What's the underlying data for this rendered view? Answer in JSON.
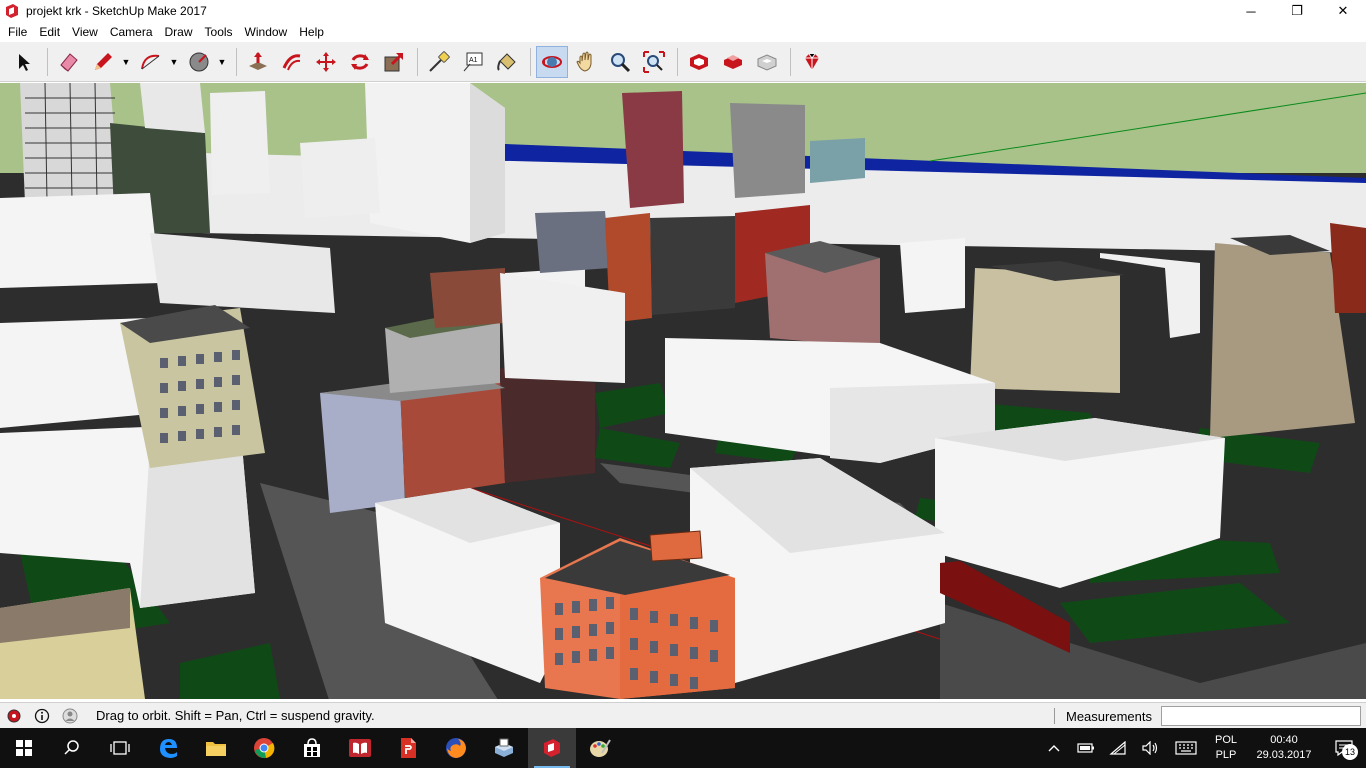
{
  "window": {
    "title": "projekt krk - SketchUp Make 2017",
    "controls": {
      "minimize": "─",
      "maximize": "❐",
      "close": "✕"
    }
  },
  "menu": [
    "File",
    "Edit",
    "View",
    "Camera",
    "Draw",
    "Tools",
    "Window",
    "Help"
  ],
  "toolbar": {
    "tools": [
      "select-tool",
      "eraser-tool",
      "pencil-tool",
      "arc-tool",
      "shapes-tool",
      "push-pull-tool",
      "offset-tool",
      "move-tool",
      "rotate-tool",
      "scale-tool",
      "tape-measure-tool",
      "text-tool",
      "paint-bucket-tool",
      "orbit-tool",
      "pan-tool",
      "zoom-tool",
      "zoom-extents-tool",
      "warehouse-tool",
      "extension-warehouse-tool",
      "layout-tool",
      "extension-manager-tool"
    ],
    "active_tool": "orbit-tool",
    "text_tool_label": "A1"
  },
  "status": {
    "hint": "Drag to orbit. Shift = Pan, Ctrl = suspend gravity.",
    "measurements_label": "Measurements",
    "measurements_value": ""
  },
  "taskbar": {
    "apps": [
      "start-icon",
      "search-icon",
      "task-view-icon",
      "edge-icon",
      "file-explorer-icon",
      "chrome-icon",
      "store-icon",
      "reader-icon",
      "pdf-icon",
      "firefox-icon",
      "scanner-icon",
      "sketchup-icon",
      "paint-icon"
    ],
    "active_app": "sketchup-icon",
    "language": [
      "POL",
      "PLP"
    ],
    "time": "00:40",
    "date": "29.03.2017",
    "notifications": "13"
  },
  "colors": {
    "sky": "#a8c28a",
    "ground": "#2d2d2d",
    "grass": "#0f4a16",
    "massing": "#f4f4f4",
    "accent_red": "#c0161c"
  }
}
